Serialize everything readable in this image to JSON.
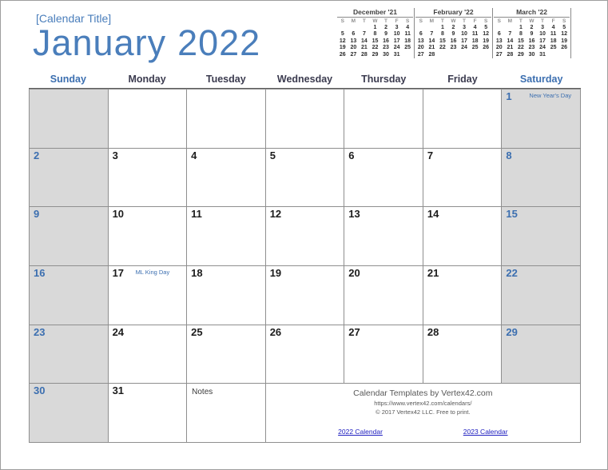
{
  "header": {
    "calendar_title": "[Calendar Title]",
    "month": "January",
    "year": "2022",
    "title_color": "#4a7ebb"
  },
  "mini_calendars": [
    {
      "title": "December '21",
      "dow": [
        "S",
        "M",
        "T",
        "W",
        "T",
        "F",
        "S"
      ],
      "weeks": [
        [
          "",
          "",
          "",
          "1",
          "2",
          "3",
          "4"
        ],
        [
          "5",
          "6",
          "7",
          "8",
          "9",
          "10",
          "11"
        ],
        [
          "12",
          "13",
          "14",
          "15",
          "16",
          "17",
          "18"
        ],
        [
          "19",
          "20",
          "21",
          "22",
          "23",
          "24",
          "25"
        ],
        [
          "26",
          "27",
          "28",
          "29",
          "30",
          "31",
          ""
        ]
      ]
    },
    {
      "title": "February '22",
      "dow": [
        "S",
        "M",
        "T",
        "W",
        "T",
        "F",
        "S"
      ],
      "weeks": [
        [
          "",
          "",
          "1",
          "2",
          "3",
          "4",
          "5"
        ],
        [
          "6",
          "7",
          "8",
          "9",
          "10",
          "11",
          "12"
        ],
        [
          "13",
          "14",
          "15",
          "16",
          "17",
          "18",
          "19"
        ],
        [
          "20",
          "21",
          "22",
          "23",
          "24",
          "25",
          "26"
        ],
        [
          "27",
          "28",
          "",
          "",
          "",
          "",
          ""
        ]
      ]
    },
    {
      "title": "March '22",
      "dow": [
        "S",
        "M",
        "T",
        "W",
        "T",
        "F",
        "S"
      ],
      "weeks": [
        [
          "",
          "",
          "1",
          "2",
          "3",
          "4",
          "5"
        ],
        [
          "6",
          "7",
          "8",
          "9",
          "10",
          "11",
          "12"
        ],
        [
          "13",
          "14",
          "15",
          "16",
          "17",
          "18",
          "19"
        ],
        [
          "20",
          "21",
          "22",
          "23",
          "24",
          "25",
          "26"
        ],
        [
          "27",
          "28",
          "29",
          "30",
          "31",
          "",
          ""
        ]
      ]
    }
  ],
  "weekday_headers": [
    {
      "label": "Sunday",
      "weekend": true
    },
    {
      "label": "Monday",
      "weekend": false
    },
    {
      "label": "Tuesday",
      "weekend": false
    },
    {
      "label": "Wednesday",
      "weekend": false
    },
    {
      "label": "Thursday",
      "weekend": false
    },
    {
      "label": "Friday",
      "weekend": false
    },
    {
      "label": "Saturday",
      "weekend": true
    }
  ],
  "grid": {
    "weeks": [
      [
        {
          "day": "",
          "event": ""
        },
        {
          "day": "",
          "event": ""
        },
        {
          "day": "",
          "event": ""
        },
        {
          "day": "",
          "event": ""
        },
        {
          "day": "",
          "event": ""
        },
        {
          "day": "",
          "event": ""
        },
        {
          "day": "1",
          "event": "New Year's Day"
        }
      ],
      [
        {
          "day": "2",
          "event": ""
        },
        {
          "day": "3",
          "event": ""
        },
        {
          "day": "4",
          "event": ""
        },
        {
          "day": "5",
          "event": ""
        },
        {
          "day": "6",
          "event": ""
        },
        {
          "day": "7",
          "event": ""
        },
        {
          "day": "8",
          "event": ""
        }
      ],
      [
        {
          "day": "9",
          "event": ""
        },
        {
          "day": "10",
          "event": ""
        },
        {
          "day": "11",
          "event": ""
        },
        {
          "day": "12",
          "event": ""
        },
        {
          "day": "13",
          "event": ""
        },
        {
          "day": "14",
          "event": ""
        },
        {
          "day": "15",
          "event": ""
        }
      ],
      [
        {
          "day": "16",
          "event": ""
        },
        {
          "day": "17",
          "event": "ML King Day"
        },
        {
          "day": "18",
          "event": ""
        },
        {
          "day": "19",
          "event": ""
        },
        {
          "day": "20",
          "event": ""
        },
        {
          "day": "21",
          "event": ""
        },
        {
          "day": "22",
          "event": ""
        }
      ],
      [
        {
          "day": "23",
          "event": ""
        },
        {
          "day": "24",
          "event": ""
        },
        {
          "day": "25",
          "event": ""
        },
        {
          "day": "26",
          "event": ""
        },
        {
          "day": "27",
          "event": ""
        },
        {
          "day": "28",
          "event": ""
        },
        {
          "day": "29",
          "event": ""
        }
      ],
      [
        {
          "day": "30",
          "event": ""
        },
        {
          "day": "31",
          "event": ""
        },
        {
          "day": "",
          "event": "",
          "notes_label": "Notes"
        }
      ]
    ]
  },
  "footer": {
    "credit_line1": "Calendar Templates by Vertex42.com",
    "credit_line2": "https://www.vertex42.com/calendars/",
    "credit_line3": "© 2017 Vertex42 LLC. Free to print.",
    "link_prev": "2022 Calendar",
    "link_next": "2023 Calendar",
    "link_color": "#2020c0"
  }
}
